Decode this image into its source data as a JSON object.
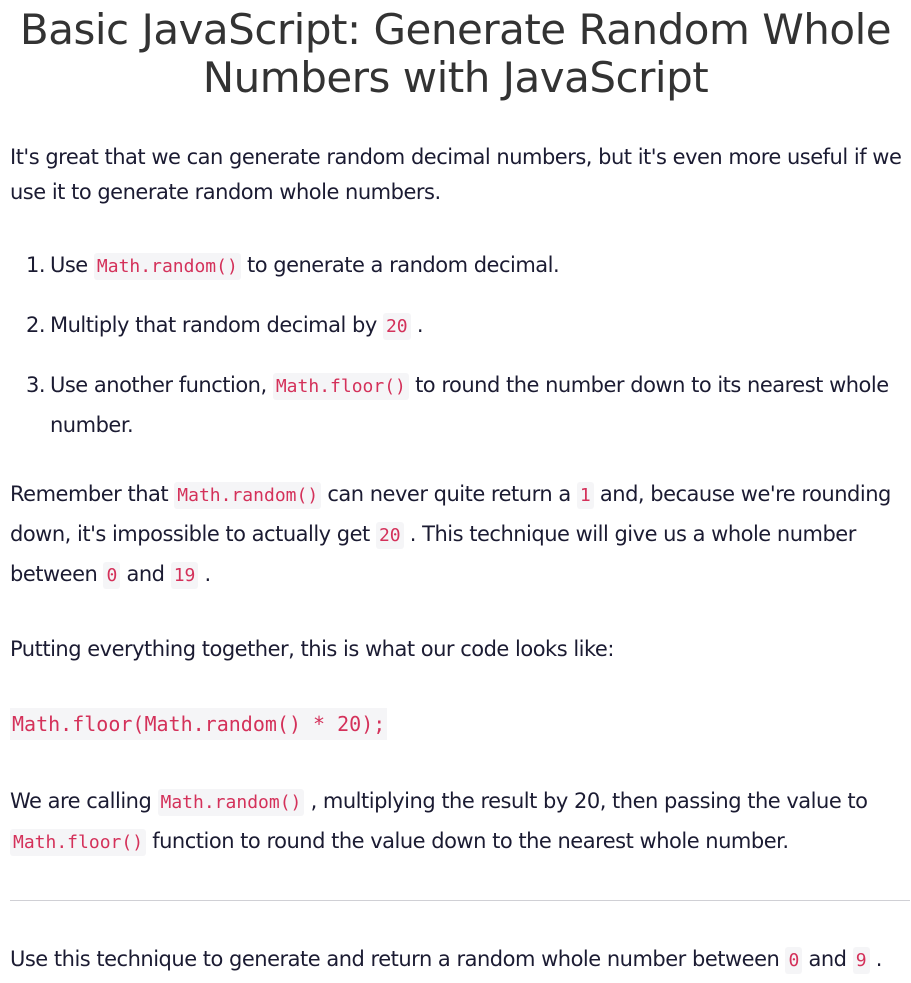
{
  "title": "Basic JavaScript: Generate Random Whole Numbers with JavaScript",
  "intro": "It's great that we can generate random decimal numbers, but it's even more useful if we use it to generate random whole numbers.",
  "steps": [
    {
      "number": "1.",
      "before": "Use ",
      "code": "Math.random()",
      "after": " to generate a random decimal."
    },
    {
      "number": "2.",
      "before": "Multiply that random decimal by ",
      "code": "20",
      "after": " ."
    },
    {
      "number": "3.",
      "before": "Use another function, ",
      "code": "Math.floor()",
      "after": " to round the number down to its nearest whole number."
    }
  ],
  "remember": {
    "t1": "Remember that ",
    "c1": "Math.random()",
    "t2": " can never quite return a ",
    "c2": "1",
    "t3": " and, because we're rounding down, it's impossible to actually get ",
    "c3": "20",
    "t4": " . This technique will give us a whole number between ",
    "c4": "0",
    "t5": " and ",
    "c5": "19",
    "t6": " ."
  },
  "together": "Putting everything together, this is what our code looks like:",
  "code_example": "Math.floor(Math.random() * 20);",
  "calling": {
    "t1": "We are calling ",
    "c1": "Math.random()",
    "t2": " , multiplying the result by 20, then passing the value to ",
    "c2": "Math.floor()",
    "t3": " function to round the value down to the nearest whole number."
  },
  "instruction": {
    "t1": "Use this technique to generate and return a random whole number between ",
    "c1": "0",
    "t2": " and ",
    "c2": "9",
    "t3": " ."
  },
  "colors": {
    "code_text": "#d4315a",
    "code_bg": "#f5f5f7",
    "body_text": "#1b1b32"
  }
}
